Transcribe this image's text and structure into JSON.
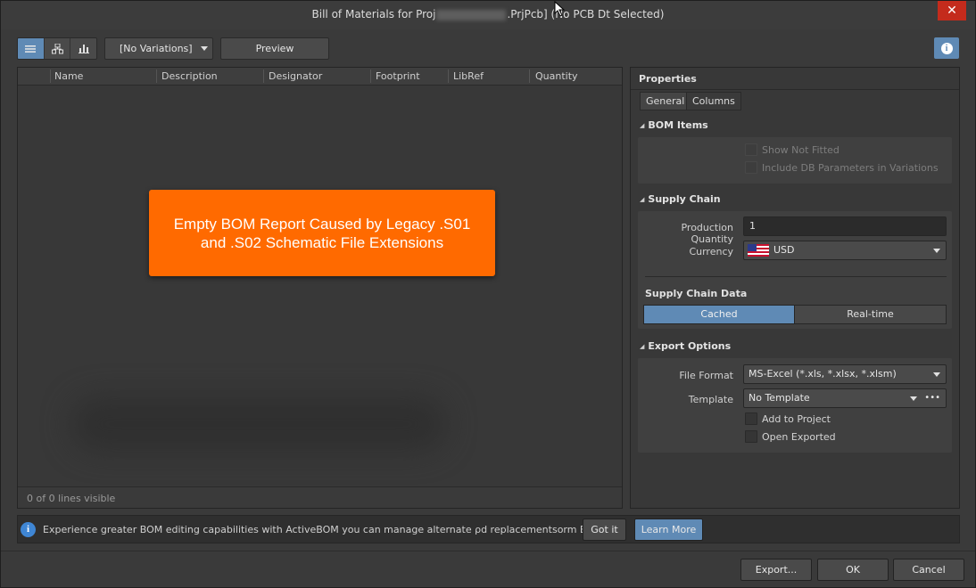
{
  "window": {
    "title_prefix": "Bill of Materials for Proj",
    "title_suffix": ".PrjPcb] (No PCB Dt Selected)",
    "close_glyph": "✕"
  },
  "toolbar": {
    "variations_label": "[No Variations]",
    "preview_label": "Preview",
    "info_glyph": "i",
    "view_icons": [
      "list-view-icon",
      "tree-view-icon",
      "chart-view-icon"
    ]
  },
  "grid": {
    "columns": [
      "Name",
      "Description",
      "Designator",
      "Footprint",
      "LibRef",
      "Quantity"
    ],
    "footer_status": "0 of 0 lines visible"
  },
  "callout": {
    "line1": "Empty BOM Report Caused by Legacy .S01",
    "line2": "and .S02 Schematic File Extensions",
    "color": "#ff6a00"
  },
  "properties": {
    "title": "Properties",
    "tabs": [
      "General",
      "Columns"
    ],
    "bom_items": {
      "heading": "BOM Items",
      "show_not_fitted": "Show Not Fitted",
      "include_db_params": "Include DB Parameters in Variations"
    },
    "supply_chain": {
      "heading": "Supply Chain",
      "production_quantity_label": "Production Quantity",
      "production_quantity_value": "1",
      "currency_label": "Currency",
      "currency_value": "USD",
      "data_label": "Supply Chain Data",
      "mode_cached": "Cached",
      "mode_realtime": "Real-time",
      "selected_mode": "Cached"
    },
    "export_options": {
      "heading": "Export Options",
      "file_format_label": "File Format",
      "file_format_value": "MS-Excel (*.xls, *.xlsx, *.xlsm)",
      "template_label": "Template",
      "template_value": "No Template",
      "template_more": "•••",
      "add_to_project": "Add to Project",
      "open_exported": "Open Exported"
    }
  },
  "notification": {
    "icon_glyph": "i",
    "text": "Experience greater BOM editing capabilities with ActiveBOM you can manage alternate ρd replacementsorm BOM checks an",
    "got_it": "Got it",
    "learn_more": "Learn More"
  },
  "footer": {
    "export": "Export...",
    "ok": "OK",
    "cancel": "Cancel"
  },
  "colors": {
    "accent": "#5f8ab5",
    "background": "#3a3a3a",
    "close": "#c42b1c"
  }
}
